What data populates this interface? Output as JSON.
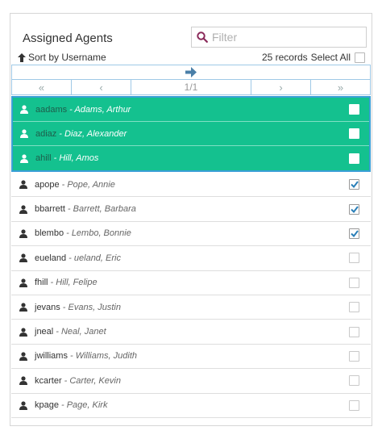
{
  "panel": {
    "title": "Assigned Agents",
    "filter_placeholder": "Filter"
  },
  "toolbar": {
    "sort_label": "Sort by Username",
    "record_count": "25 records",
    "select_all_label": "Select All"
  },
  "pager": {
    "first": "«",
    "prev": "‹",
    "page_indicator": "1/1",
    "next": "›",
    "last": "»"
  },
  "selected_agents": [
    {
      "username": "aadams",
      "full_name": "Adams, Arthur",
      "checked": false
    },
    {
      "username": "adiaz",
      "full_name": "Diaz, Alexander",
      "checked": false
    },
    {
      "username": "ahill",
      "full_name": "Hill, Amos",
      "checked": false
    }
  ],
  "agents": [
    {
      "username": "apope",
      "full_name": "Pope, Annie",
      "checked": true
    },
    {
      "username": "bbarrett",
      "full_name": "Barrett, Barbara",
      "checked": true
    },
    {
      "username": "blembo",
      "full_name": "Lembo, Bonnie",
      "checked": true
    },
    {
      "username": "eueland",
      "full_name": "ueland, Eric",
      "checked": false
    },
    {
      "username": "fhill",
      "full_name": "Hill, Felipe",
      "checked": false
    },
    {
      "username": "jevans",
      "full_name": "Evans, Justin",
      "checked": false
    },
    {
      "username": "jneal",
      "full_name": "Neal, Janet",
      "checked": false
    },
    {
      "username": "jwilliams",
      "full_name": "Williams, Judith",
      "checked": false
    },
    {
      "username": "kcarter",
      "full_name": "Carter, Kevin",
      "checked": false
    },
    {
      "username": "kpage",
      "full_name": "Page, Kirk",
      "checked": false
    }
  ],
  "icons": {
    "search": "search-icon",
    "sort": "arrow-up-icon",
    "move": "arrow-right-icon",
    "user": "user-icon",
    "check": "check-icon"
  },
  "colors": {
    "selected_bg": "#14c18f",
    "selected_border": "#3a9fd6",
    "accent_check": "#2a7fb8",
    "search_icon": "#8a2a5a",
    "move_arrow": "#4a7fa8"
  }
}
